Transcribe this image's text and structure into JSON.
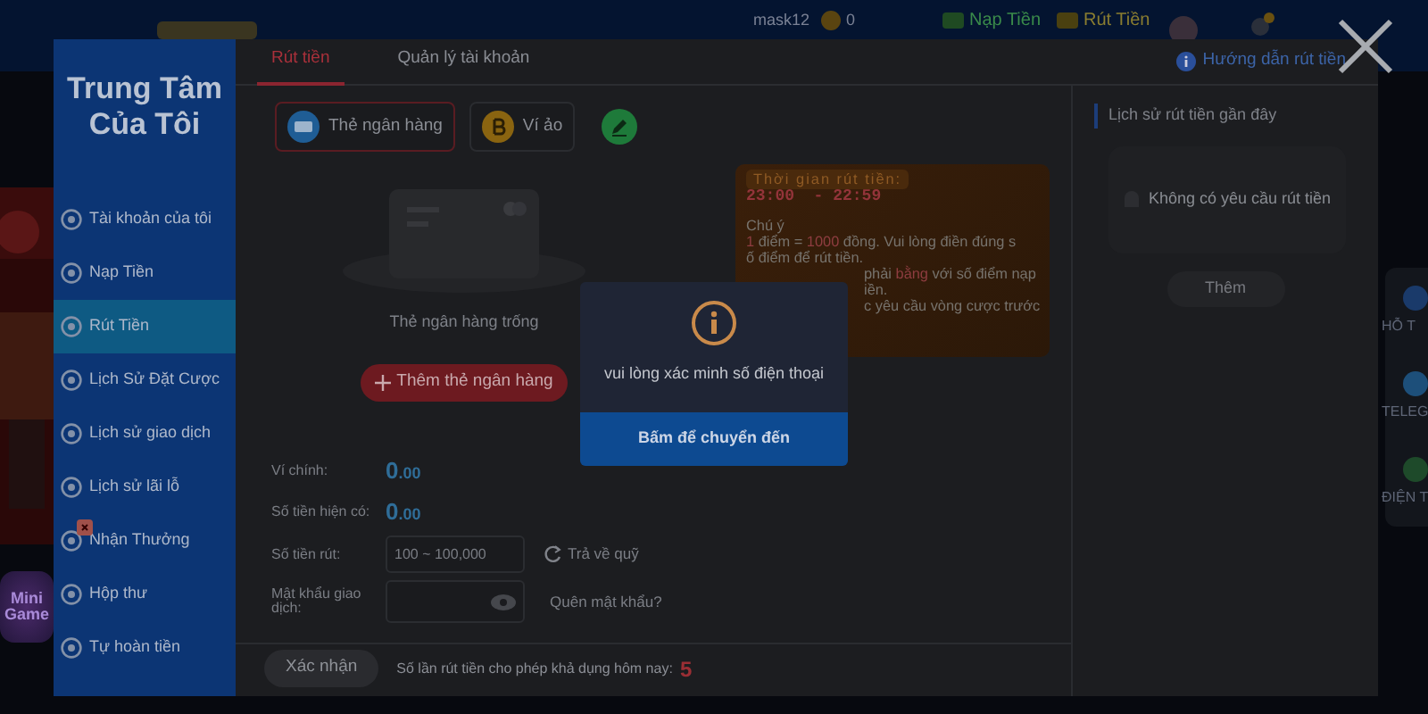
{
  "background_site": {
    "username": "mask12",
    "balance": "0",
    "deposit": "Nạp Tiền",
    "withdraw": "Rút Tiền",
    "side_widget": [
      "HỖ T",
      "TELEG",
      "ĐIỆN T"
    ],
    "minigame": "Mini Game"
  },
  "sidebar": {
    "title": "Trung Tâm Của Tôi",
    "items": [
      {
        "label": "Tài khoản của tôi",
        "selected": false
      },
      {
        "label": "Nạp Tiền",
        "selected": false
      },
      {
        "label": "Rút Tiền",
        "selected": true
      },
      {
        "label": "Lịch Sử Đặt Cược",
        "selected": false
      },
      {
        "label": "Lịch sử giao dịch",
        "selected": false
      },
      {
        "label": "Lịch sử lãi lỗ",
        "selected": false
      },
      {
        "label": "Nhận Thưởng",
        "selected": false
      },
      {
        "label": "Hộp thư",
        "selected": false
      },
      {
        "label": "Tự hoàn tiền",
        "selected": false
      }
    ]
  },
  "tabs": [
    {
      "label": "Rút tiền",
      "selected": true
    },
    {
      "label": "Quản lý tài khoản",
      "selected": false
    }
  ],
  "help_link": "Hướng dẫn rút tiền",
  "methods": [
    {
      "kind": "bank",
      "label": "Thẻ ngân hàng",
      "selected": true
    },
    {
      "kind": "crypto",
      "label": "Ví ảo",
      "selected": false
    },
    {
      "kind": "edit",
      "selected": false
    }
  ],
  "bank_card": {
    "empty_text": "Thẻ ngân hàng trống",
    "add_button": "Thêm thẻ ngân hàng"
  },
  "notice": {
    "time_label": "Thời gian rút tiền:",
    "time_range": "23:00  - 22:59",
    "title": "Chú ý",
    "lines": [
      {
        "kind": "full",
        "segments": [
          {
            "text": "1",
            "highlight": true
          },
          {
            "text": " điểm = ",
            "highlight": false
          },
          {
            "text": "1000",
            "highlight": true
          },
          {
            "text": " đồng. Vui lòng điền đúng s",
            "highlight": false
          }
        ]
      },
      {
        "kind": "full",
        "segments": [
          {
            "text": "ố điểm để rút tiền.",
            "highlight": false
          }
        ]
      },
      {
        "kind": "fragment",
        "segments": [
          {
            "text": "phải ",
            "highlight": false
          },
          {
            "text": "bằng",
            "highlight": true
          },
          {
            "text": " với số điểm nạp",
            "highlight": false
          }
        ]
      },
      {
        "kind": "fragment",
        "segments": [
          {
            "text": "iền.",
            "highlight": false
          }
        ]
      },
      {
        "kind": "fragment",
        "segments": [
          {
            "text": "c yêu cầu vòng cược trước",
            "highlight": false
          }
        ]
      }
    ]
  },
  "form": [
    {
      "kind": "amount",
      "label": "Ví chính:",
      "integer": "0",
      "decimal": ".00"
    },
    {
      "kind": "amount",
      "label": "Số tiền hiện có:",
      "integer": "0",
      "decimal": ".00"
    },
    {
      "kind": "input",
      "label": "Số tiền rút:",
      "placeholder": "100 ~ 100,000",
      "action": "Trả về quỹ"
    },
    {
      "kind": "password",
      "label": "Mật khẩu giao dịch:",
      "action": "Quên mật khẩu?"
    }
  ],
  "footer": {
    "confirm": "Xác nhận",
    "limit_text": "Số lần rút tiền cho phép khả dụng hôm nay:",
    "limit_count": "5"
  },
  "history": {
    "title": "Lịch sử rút tiền gần đây",
    "empty": "Không có yêu cầu rút tiền",
    "more": "Thêm"
  },
  "modal": {
    "message": "vui lòng xác minh số điện thoại",
    "button": "Bấm để chuyển đến"
  }
}
